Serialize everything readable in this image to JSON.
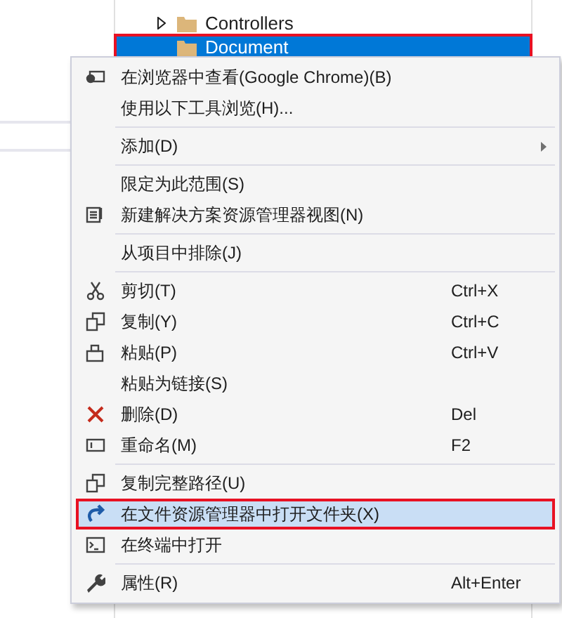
{
  "tree": {
    "items": [
      {
        "label": "Controllers",
        "expandable": true,
        "selected": false,
        "outlined": false
      },
      {
        "label": "Document",
        "expandable": false,
        "selected": true,
        "outlined": true
      }
    ]
  },
  "context_menu": {
    "items": [
      {
        "kind": "item",
        "label": "在浏览器中查看(Google Chrome)(B)",
        "selected": false,
        "outlined": false
      },
      {
        "kind": "item",
        "label": "使用以下工具浏览(H)...",
        "selected": false,
        "outlined": false
      },
      {
        "kind": "separator"
      },
      {
        "kind": "item",
        "label": "添加(D)",
        "submenu": true,
        "selected": false,
        "outlined": false
      },
      {
        "kind": "separator"
      },
      {
        "kind": "item",
        "label": "限定为此范围(S)",
        "selected": false,
        "outlined": false
      },
      {
        "kind": "item",
        "label": "新建解决方案资源管理器视图(N)",
        "selected": false,
        "outlined": false
      },
      {
        "kind": "separator"
      },
      {
        "kind": "item",
        "label": "从项目中排除(J)",
        "selected": false,
        "outlined": false
      },
      {
        "kind": "separator"
      },
      {
        "kind": "item",
        "label": "剪切(T)",
        "shortcut": "Ctrl+X",
        "selected": false,
        "outlined": false
      },
      {
        "kind": "item",
        "label": "复制(Y)",
        "shortcut": "Ctrl+C",
        "selected": false,
        "outlined": false
      },
      {
        "kind": "item",
        "label": "粘贴(P)",
        "shortcut": "Ctrl+V",
        "selected": false,
        "outlined": false
      },
      {
        "kind": "item",
        "label": "粘贴为链接(S)",
        "selected": false,
        "outlined": false
      },
      {
        "kind": "item",
        "label": "删除(D)",
        "shortcut": "Del",
        "selected": false,
        "outlined": false
      },
      {
        "kind": "item",
        "label": "重命名(M)",
        "shortcut": "F2",
        "selected": false,
        "outlined": false
      },
      {
        "kind": "separator"
      },
      {
        "kind": "item",
        "label": "复制完整路径(U)",
        "selected": false,
        "outlined": false
      },
      {
        "kind": "item",
        "label": "在文件资源管理器中打开文件夹(X)",
        "selected": true,
        "outlined": true
      },
      {
        "kind": "item",
        "label": "在终端中打开",
        "selected": false,
        "outlined": false
      },
      {
        "kind": "separator"
      },
      {
        "kind": "item",
        "label": "属性(R)",
        "shortcut": "Alt+Enter",
        "selected": false,
        "outlined": false
      }
    ]
  }
}
